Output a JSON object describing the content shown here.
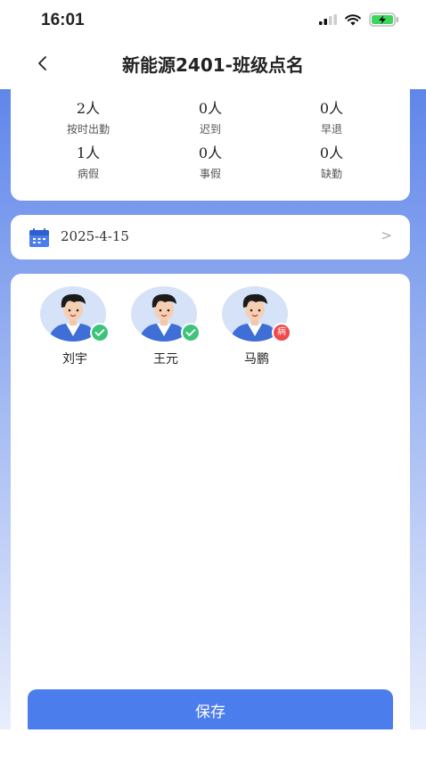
{
  "status_bar": {
    "time": "16:01"
  },
  "nav": {
    "title": "新能源2401-班级点名",
    "back_glyph": "<"
  },
  "stats": [
    {
      "count": "2人",
      "label": "按时出勤"
    },
    {
      "count": "0人",
      "label": "迟到"
    },
    {
      "count": "0人",
      "label": "早退"
    },
    {
      "count": "1人",
      "label": "病假"
    },
    {
      "count": "0人",
      "label": "事假"
    },
    {
      "count": "0人",
      "label": "缺勤"
    }
  ],
  "date_row": {
    "date": "2025-4-15",
    "chevron": ">",
    "icon": "calendar-icon"
  },
  "students": [
    {
      "name": "刘宇",
      "status": "present",
      "badge_icon": "check-icon"
    },
    {
      "name": "王元",
      "status": "present",
      "badge_icon": "check-icon"
    },
    {
      "name": "马鹏",
      "status": "sick_leave",
      "badge_text": "病"
    }
  ],
  "colors": {
    "primary": "#4c7ded",
    "present": "#3ec47a",
    "sick": "#f04b4b"
  },
  "save_label": "保存"
}
